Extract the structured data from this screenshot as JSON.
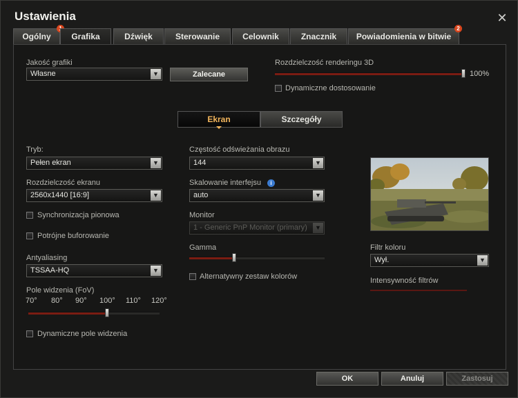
{
  "window": {
    "title": "Ustawienia"
  },
  "tabs": [
    {
      "label": "Ogólny",
      "badge": "1"
    },
    {
      "label": "Grafika"
    },
    {
      "label": "Dźwięk"
    },
    {
      "label": "Sterowanie"
    },
    {
      "label": "Celownik"
    },
    {
      "label": "Znacznik"
    },
    {
      "label": "Powiadomienia w bitwie",
      "badge": "2"
    }
  ],
  "graphics": {
    "quality_label": "Jakość grafiki",
    "quality_value": "Własne",
    "recommended_button": "Zalecane",
    "render_res_label": "Rozdzielczość renderingu 3D",
    "render_res_value": "100%",
    "render_res_level": 1.0,
    "dynamic_adjust_label": "Dynamiczne dostosowanie"
  },
  "subtabs": {
    "screen": "Ekran",
    "details": "Szczegóły"
  },
  "screen": {
    "mode_label": "Tryb:",
    "mode_value": "Pełen ekran",
    "resolution_label": "Rozdzielczość ekranu",
    "resolution_value": "2560x1440 [16:9]",
    "vsync_label": "Synchronizacja pionowa",
    "triple_buffer_label": "Potrójne buforowanie",
    "aa_label": "Antyaliasing",
    "aa_value": "TSSAA-HQ",
    "fov_label": "Pole widzenia (FoV)",
    "fov_ticks": [
      "70°",
      "80°",
      "90°",
      "100°",
      "110°",
      "120°"
    ],
    "fov_level": 0.6,
    "dynamic_fov_label": "Dynamiczne pole widzenia",
    "refresh_label": "Częstość odświeżania obrazu",
    "refresh_value": "144",
    "ui_scale_label": "Skalowanie interfejsu",
    "ui_scale_value": "auto",
    "monitor_label": "Monitor",
    "monitor_value": "1 - Generic PnP Monitor (primary)",
    "gamma_label": "Gamma",
    "gamma_level": 0.33,
    "alt_colors_label": "Alternatywny zestaw kolorów",
    "color_filter_label": "Filtr koloru",
    "color_filter_value": "Wył.",
    "filter_intensity_label": "Intensywność filtrów"
  },
  "footer": {
    "ok": "OK",
    "cancel": "Anuluj",
    "apply": "Zastosuj"
  },
  "colors": {
    "accent_orange": "#f2b55c",
    "slider_red": "#7b1c12",
    "badge": "#d9461e",
    "info_blue": "#3b7bd0"
  }
}
